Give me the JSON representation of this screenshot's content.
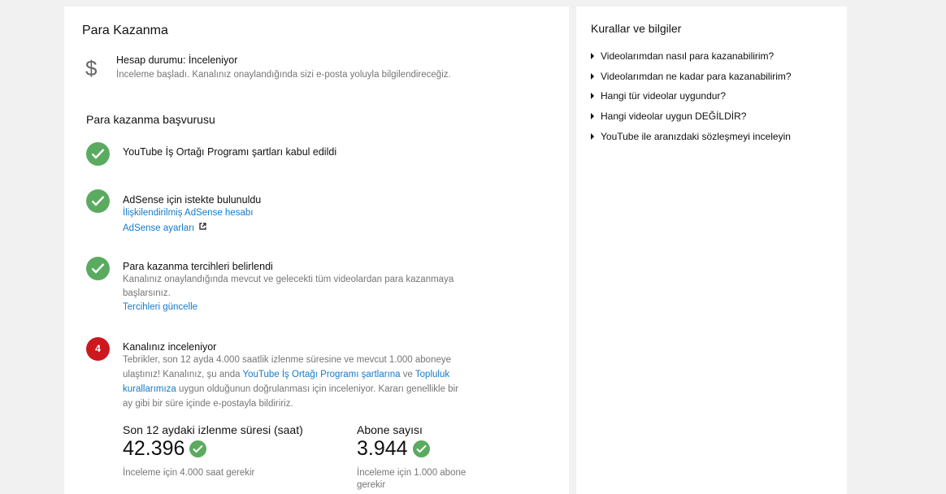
{
  "monetization": {
    "title": "Para Kazanma",
    "account_status": {
      "label": "Hesap durumu: İnceleniyor",
      "desc": "İnceleme başladı. Kanalınız onaylandığında sizi e-posta yoluyla bilgilendireceğiz."
    },
    "application_title": "Para kazanma başvurusu",
    "steps": [
      {
        "title": "YouTube İş Ortağı Programı şartları kabul edildi"
      },
      {
        "title": "AdSense için istekte bulunuldu",
        "link1": "İlişkilendirilmiş AdSense hesabı",
        "link2": "AdSense ayarları"
      },
      {
        "title": "Para kazanma tercihleri belirlendi",
        "desc_line1": "Kanalınız onaylandığında mevcut ve gelecekti tüm videolardan para kazanmaya",
        "desc_line2": "başlarsınız.",
        "link": "Tercihleri güncelle"
      },
      {
        "number": "4",
        "title": "Kanalınız inceleniyor",
        "desc_line1": "Tebrikler, son 12 ayda 4.000 saatlik izlenme süresine ve mevcut 1.000 aboneye",
        "desc_line2_a": "ulaştınız! Kanalınız, şu anda ",
        "desc_line2_link1": "YouTube İş Ortağı Programı şartlarına",
        "desc_line2_b": " ve ",
        "desc_line2_link2": "Topluluk",
        "desc_line3_link": "kurallarımıza",
        "desc_line3_b": " uygun olduğunun doğrulanması için inceleniyor. Kararı genellikle bir",
        "desc_line4": "ay gibi bir süre içinde e-postayla bildiririz."
      }
    ],
    "stats": {
      "watch_label": "Son 12 aydaki izlenme süresi (saat)",
      "watch_value": "42.396",
      "watch_req": "İnceleme için 4.000 saat gerekir",
      "subs_label": "Abone sayısı",
      "subs_value": "3.944",
      "subs_req_line1": "İnceleme için 1.000 abone",
      "subs_req_line2": "gerekir"
    }
  },
  "rules": {
    "title": "Kurallar ve bilgiler",
    "items": [
      "Videolarımdan nasıl para kazanabilirim?",
      "Videolarımdan ne kadar para kazanabilirim?",
      "Hangi tür videolar uygundur?",
      "Hangi videolar uygun DEĞİLDİR?",
      "YouTube ile aranızdaki sözleşmeyi inceleyin"
    ]
  },
  "colors": {
    "check_green": "#5aab60",
    "step_red": "#cc181e",
    "link_blue": "#167ac6"
  },
  "icons": {
    "status": "dollar-icon",
    "external": "external-link-icon"
  }
}
